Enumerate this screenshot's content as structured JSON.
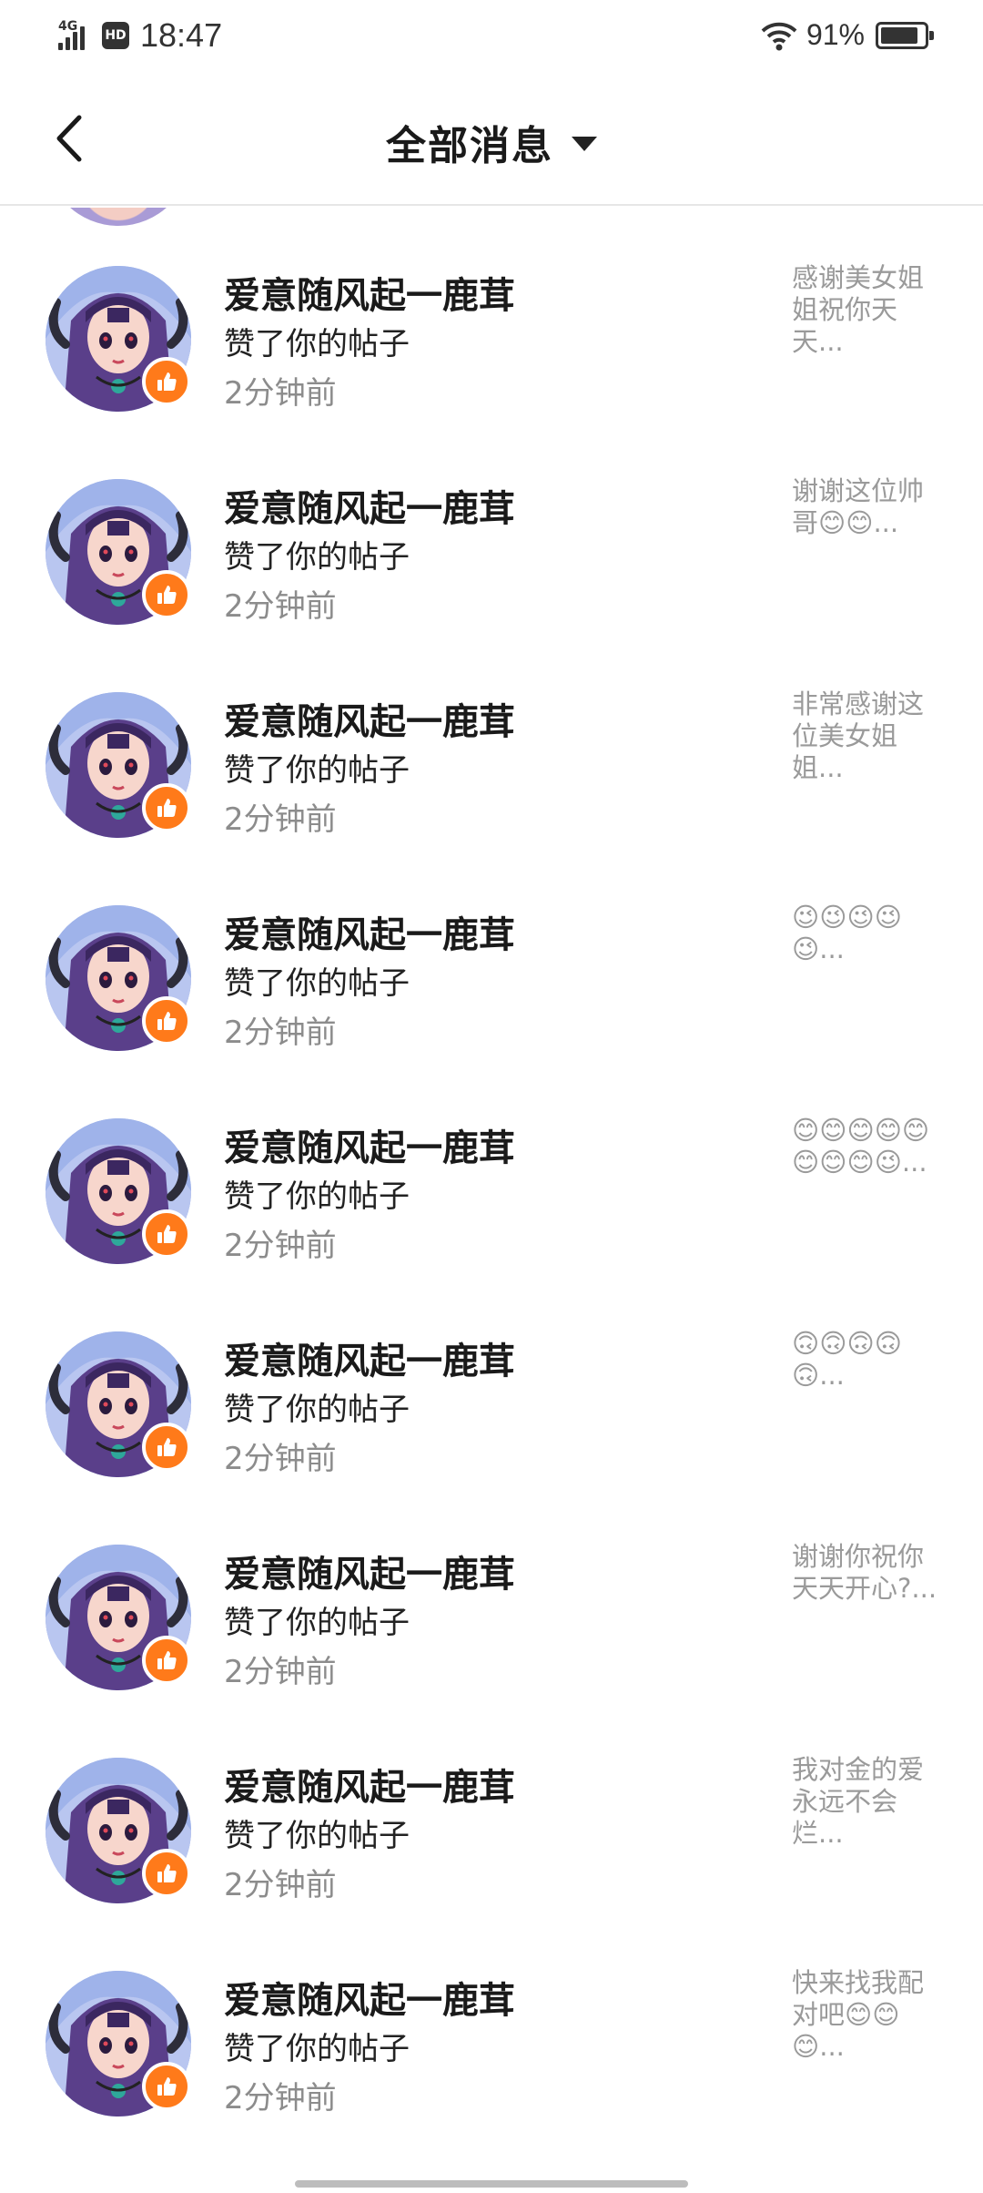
{
  "status_bar": {
    "network": "4G",
    "hd_label": "HD",
    "time": "18:47",
    "battery_percent": "91%",
    "battery_level": 0.91
  },
  "header": {
    "title": "全部消息",
    "back_icon": "chevron-left-icon",
    "dropdown_icon": "caret-down-icon"
  },
  "colors": {
    "badge": "#ff7a1a",
    "muted": "#8c8c8c",
    "divider": "#e6e6e6"
  },
  "notifications": [
    {
      "user": "爱意随风起一鹿茸",
      "action": "赞了你的帖子",
      "time": "2分钟前",
      "preview": "感谢美女姐姐祝你天天..."
    },
    {
      "user": "爱意随风起一鹿茸",
      "action": "赞了你的帖子",
      "time": "2分钟前",
      "preview": "谢谢这位帅哥😊😊..."
    },
    {
      "user": "爱意随风起一鹿茸",
      "action": "赞了你的帖子",
      "time": "2分钟前",
      "preview": "非常感谢这位美女姐姐..."
    },
    {
      "user": "爱意随风起一鹿茸",
      "action": "赞了你的帖子",
      "time": "2分钟前",
      "preview": "😉😉😉😉😉..."
    },
    {
      "user": "爱意随风起一鹿茸",
      "action": "赞了你的帖子",
      "time": "2分钟前",
      "preview": "😊😊😊😊😊😊😊😊😉..."
    },
    {
      "user": "爱意随风起一鹿茸",
      "action": "赞了你的帖子",
      "time": "2分钟前",
      "preview": "🙃🙃🙃🙃🙃..."
    },
    {
      "user": "爱意随风起一鹿茸",
      "action": "赞了你的帖子",
      "time": "2分钟前",
      "preview": "谢谢你祝你天天开心?..."
    },
    {
      "user": "爱意随风起一鹿茸",
      "action": "赞了你的帖子",
      "time": "2分钟前",
      "preview": "我对金的爱永远不会烂..."
    },
    {
      "user": "爱意随风起一鹿茸",
      "action": "赞了你的帖子",
      "time": "2分钟前",
      "preview": "快来找我配对吧😊😊😊..."
    }
  ]
}
